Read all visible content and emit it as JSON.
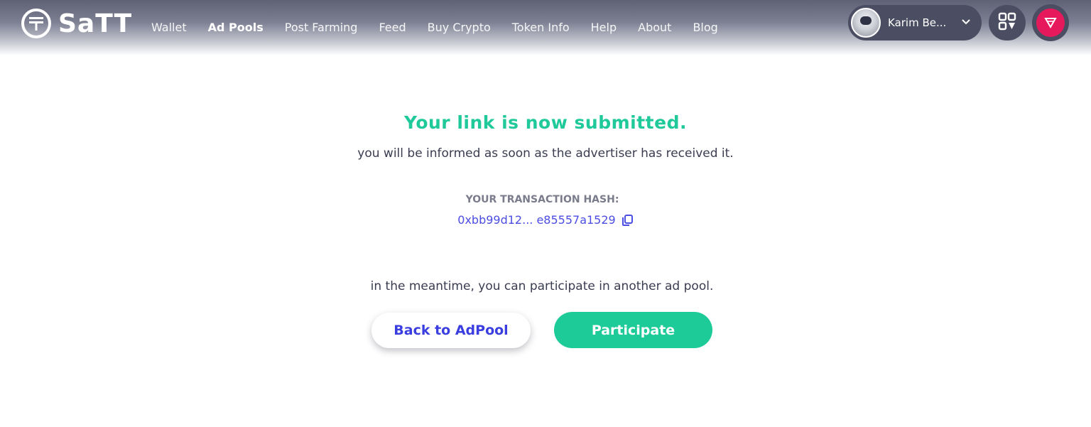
{
  "header": {
    "brand": "SaTT",
    "nav": [
      {
        "label": "Wallet",
        "active": false
      },
      {
        "label": "Ad Pools",
        "active": true
      },
      {
        "label": "Post Farming",
        "active": false
      },
      {
        "label": "Feed",
        "active": false
      },
      {
        "label": "Buy Crypto",
        "active": false
      },
      {
        "label": "Token Info",
        "active": false
      },
      {
        "label": "Help",
        "active": false
      },
      {
        "label": "About",
        "active": false
      },
      {
        "label": "Blog",
        "active": false
      }
    ],
    "user": {
      "name": "Karim Be..."
    },
    "icons": {
      "logo": "satt-logo-icon",
      "qr": "qr-code-icon",
      "gem": "gem-icon",
      "dropdown": "chevron-down-icon"
    }
  },
  "main": {
    "title": "Your link is now submitted.",
    "subtitle": "you will be informed as soon as the advertiser has received it.",
    "hash_label": "YOUR TRANSACTION HASH:",
    "hash_value": "0xbb99d12... e85557a1529",
    "meantime": "in the meantime, you can participate in another ad pool.",
    "back_button": "Back to AdPool",
    "participate_button": "Participate"
  },
  "colors": {
    "accent_green": "#1fc99a",
    "link_blue": "#4b4de3",
    "gem_pink": "#e5195c"
  }
}
